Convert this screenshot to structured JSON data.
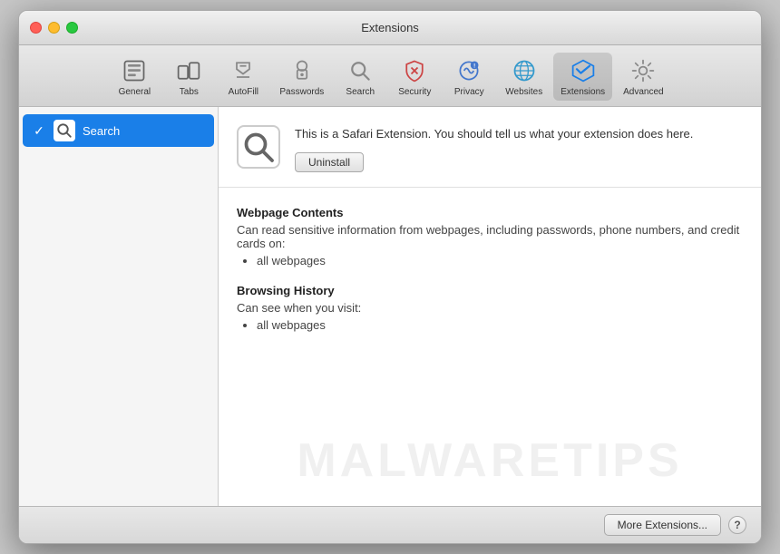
{
  "window": {
    "title": "Extensions"
  },
  "toolbar": {
    "items": [
      {
        "id": "general",
        "label": "General",
        "icon": "general"
      },
      {
        "id": "tabs",
        "label": "Tabs",
        "icon": "tabs"
      },
      {
        "id": "autofill",
        "label": "AutoFill",
        "icon": "autofill"
      },
      {
        "id": "passwords",
        "label": "Passwords",
        "icon": "passwords"
      },
      {
        "id": "search",
        "label": "Search",
        "icon": "search"
      },
      {
        "id": "security",
        "label": "Security",
        "icon": "security"
      },
      {
        "id": "privacy",
        "label": "Privacy",
        "icon": "privacy"
      },
      {
        "id": "websites",
        "label": "Websites",
        "icon": "websites"
      },
      {
        "id": "extensions",
        "label": "Extensions",
        "icon": "extensions",
        "active": true
      },
      {
        "id": "advanced",
        "label": "Advanced",
        "icon": "advanced"
      }
    ]
  },
  "sidebar": {
    "items": [
      {
        "id": "search-ext",
        "name": "Search",
        "enabled": true,
        "selected": true
      }
    ]
  },
  "detail": {
    "description": "This is a Safari Extension. You should tell us what your extension does here.",
    "uninstall_label": "Uninstall",
    "permissions": [
      {
        "title": "Webpage Contents",
        "description": "Can read sensitive information from webpages, including passwords, phone numbers, and credit cards on:",
        "items": [
          "all webpages"
        ]
      },
      {
        "title": "Browsing History",
        "description": "Can see when you visit:",
        "items": [
          "all webpages"
        ]
      }
    ]
  },
  "footer": {
    "more_extensions_label": "More Extensions...",
    "help_label": "?"
  },
  "watermark": {
    "text": "MALWARETIPS"
  }
}
